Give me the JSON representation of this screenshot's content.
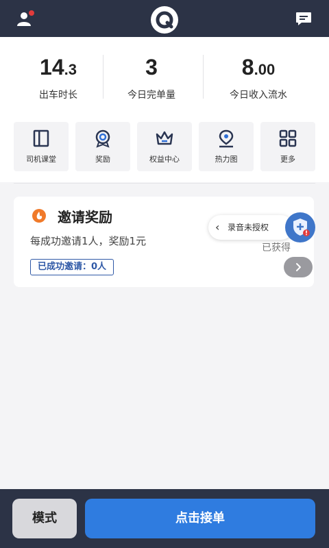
{
  "header": {
    "user_icon": "user-profile-icon",
    "logo_icon": "app-logo-icon",
    "message_icon": "message-icon",
    "colors": {
      "bar": "#2c3346",
      "notification_dot": "#e23b3b"
    }
  },
  "stats": [
    {
      "value_main": "14",
      "value_decimal": ".3",
      "label": "出车时长"
    },
    {
      "value_main": "3",
      "value_decimal": "",
      "label": "今日完单量"
    },
    {
      "value_main": "8",
      "value_decimal": ".00",
      "label": "今日收入流水"
    }
  ],
  "tools": [
    {
      "label": "司机课堂",
      "icon": "book-icon"
    },
    {
      "label": "奖励",
      "icon": "medal-icon"
    },
    {
      "label": "权益中心",
      "icon": "crown-icon"
    },
    {
      "label": "热力图",
      "icon": "map-pin-icon"
    },
    {
      "label": "更多",
      "icon": "grid-icon"
    }
  ],
  "invite_card": {
    "title": "邀请奖励",
    "description": "每成功邀请1人，奖励1元",
    "invited_badge": "已成功邀请：0人",
    "earned_label": "已获得",
    "icon": "invite-reward-icon"
  },
  "recording_notice": {
    "text": "录音未授权",
    "icon": "shield-alert-icon"
  },
  "bottom_bar": {
    "mode_label": "模式",
    "accept_label": "点击接单",
    "colors": {
      "accept": "#2f7ce0",
      "mode": "#d8d8dc"
    }
  }
}
